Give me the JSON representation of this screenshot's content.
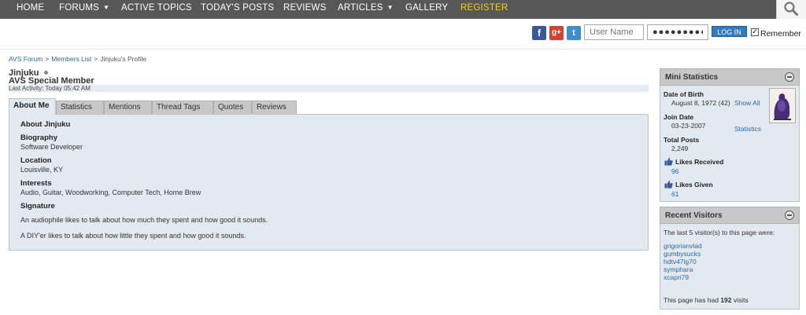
{
  "nav": {
    "items": [
      {
        "label": "HOME",
        "caret": false
      },
      {
        "label": "FORUMS",
        "caret": true
      },
      {
        "label": "ACTIVE TOPICS",
        "caret": false
      },
      {
        "label": "TODAY'S POSTS",
        "caret": false
      },
      {
        "label": "REVIEWS",
        "caret": false
      },
      {
        "label": "ARTICLES",
        "caret": true
      },
      {
        "label": "GALLERY",
        "caret": false
      }
    ],
    "register_label": "REGISTER",
    "register_color": "#f2cf2a",
    "search_icon": "search-icon"
  },
  "login": {
    "facebook_glyph": "f",
    "google_glyph": "g+",
    "twitter_glyph": "t",
    "username_placeholder": "User Name",
    "password_value": "●●●●●●●●●",
    "login_label": "LOG IN",
    "remember_label": "Remember",
    "remember_checked": true
  },
  "breadcrumb": {
    "home": "AVS Forum",
    "members": "Members List",
    "current": "Jinjuku's Profile",
    "separator": ">"
  },
  "profile": {
    "name": "Jinjuku",
    "title": "AVS Special Member",
    "last_activity": "Last Activity: Today 05:42 AM"
  },
  "tabs": [
    {
      "label": "About Me",
      "active": true
    },
    {
      "label": "Statistics",
      "active": false
    },
    {
      "label": "Mentions",
      "active": false
    },
    {
      "label": "Thread Tags",
      "active": false
    },
    {
      "label": "Quotes",
      "active": false
    },
    {
      "label": "Reviews",
      "active": false
    }
  ],
  "about": {
    "heading": "About Jinjuku",
    "biography_label": "Biography",
    "biography_value": "Software Developer",
    "location_label": "Location",
    "location_value": "Louisville, KY",
    "interests_label": "Interests",
    "interests_value": "Audio, Guitar, Woodworking, Computer Tech, Home Brew",
    "signature_label": "Signature",
    "signature_line1": "An audiophile likes to talk about how much they spent and how good it sounds.",
    "signature_line2": "A DIY'er likes to talk about how little they spent and how good it sounds."
  },
  "mini_stats": {
    "title": "Mini Statistics",
    "dob_label": "Date of Birth",
    "dob_value": "August 8, 1972 (42)",
    "show_all": "Show All",
    "join_label": "Join Date",
    "join_value": "03-23-2007",
    "statistics_link": "Statistics",
    "posts_label": "Total Posts",
    "posts_value": "2,249",
    "likes_received_label": "Likes Received",
    "likes_received_value": "96",
    "likes_given_label": "Likes Given",
    "likes_given_value": "61"
  },
  "recent_visitors": {
    "title": "Recent Visitors",
    "intro": "The last 5 visitor(s) to this page were:",
    "visitors": [
      "grigorianvlad",
      "gumbysucks",
      "hdtv47lg70",
      "symphara",
      "xcapri79"
    ],
    "footer_prefix": "This page has had",
    "visit_count": "192",
    "footer_suffix": "visits"
  }
}
